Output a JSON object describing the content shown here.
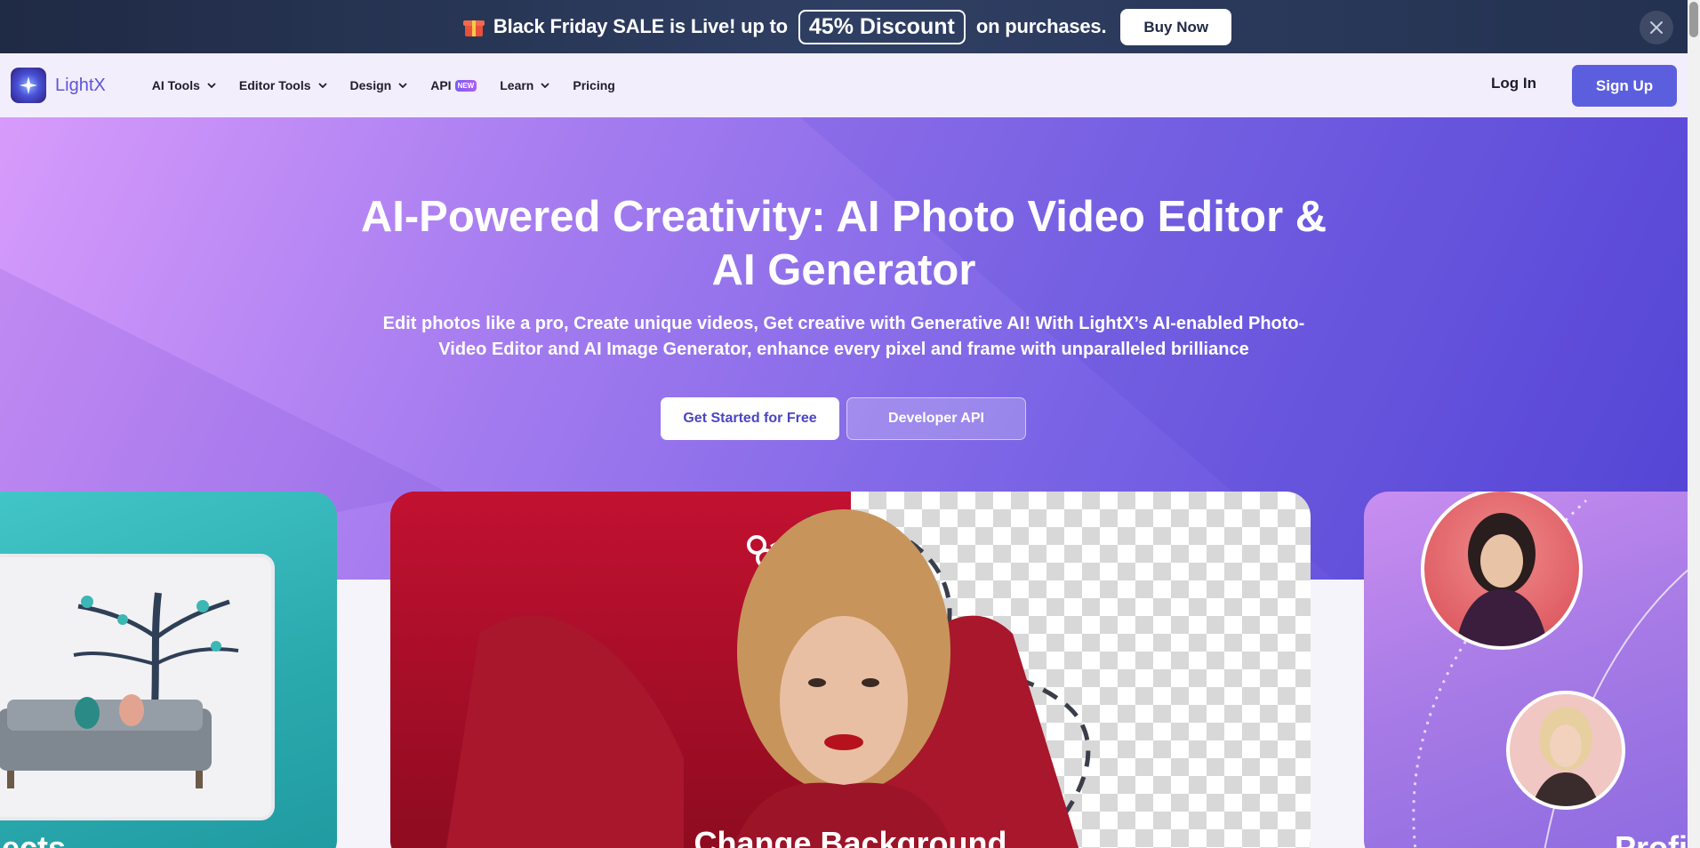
{
  "promo": {
    "text_before": "Black Friday SALE is Live! up to",
    "discount": "45% Discount",
    "text_after": "on purchases.",
    "buy_label": "Buy Now"
  },
  "nav": {
    "brand": "LightX",
    "items": [
      {
        "label": "AI Tools",
        "has_dropdown": true
      },
      {
        "label": "Editor Tools",
        "has_dropdown": true
      },
      {
        "label": "Design",
        "has_dropdown": true
      },
      {
        "label": "API",
        "badge": "NEW",
        "has_dropdown": false
      },
      {
        "label": "Learn",
        "has_dropdown": true
      },
      {
        "label": "Pricing",
        "has_dropdown": false
      }
    ],
    "login": "Log In",
    "signup": "Sign Up"
  },
  "hero": {
    "title_line1": "AI-Powered Creativity: AI Photo Video Editor &",
    "title_line2": "AI Generator",
    "subtitle_line1": "Edit photos like a pro, Create unique videos, Get creative with Generative AI! With LightX’s AI-enabled Photo-",
    "subtitle_line2": "Video Editor and AI Image Generator, enhance every pixel and frame with unparalleled brilliance",
    "cta_primary": "Get Started for Free",
    "cta_secondary": "Developer API"
  },
  "cards": {
    "left_title": "bjects",
    "center_title": "Change Background",
    "right_title": "Profi"
  },
  "colors": {
    "promo_bg": "#243150",
    "accent": "#5b5fde",
    "hero_start": "#d79bfb",
    "hero_end": "#5647d8"
  }
}
